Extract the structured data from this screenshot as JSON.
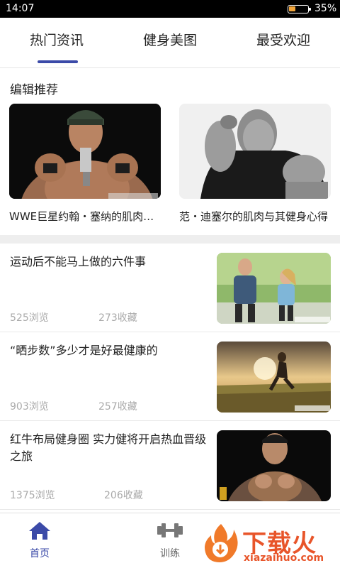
{
  "status_bar": {
    "time": "14:07",
    "battery": "35%",
    "battery_level": 0.35
  },
  "tabs": [
    {
      "label": "热门资讯",
      "active": true
    },
    {
      "label": "健身美图",
      "active": false
    },
    {
      "label": "最受欢迎",
      "active": false
    }
  ],
  "accent_color": "#3b4aa8",
  "editor_picks": {
    "title": "编辑推荐",
    "items": [
      {
        "title": "WWE巨星约翰・塞纳的肌肉…"
      },
      {
        "title": "范・迪塞尔的肌肉与其健身心得"
      }
    ]
  },
  "articles": [
    {
      "title": "运动后不能马上做的六件事",
      "views": "525浏览",
      "favorites": "273收藏"
    },
    {
      "title": "“晒步数”多少才是好最健康的",
      "views": "903浏览",
      "favorites": "257收藏"
    },
    {
      "title": "红牛布局健身圈 实力健将开启热血晋级之旅",
      "views": "1375浏览",
      "favorites": "206收藏"
    }
  ],
  "bottom_nav": [
    {
      "label": "首页",
      "icon": "home-icon",
      "active": true
    },
    {
      "label": "训练",
      "icon": "dumbbell-icon",
      "active": false
    }
  ],
  "watermark": {
    "text": "下载火",
    "sub": "xiazaihuo.com"
  }
}
